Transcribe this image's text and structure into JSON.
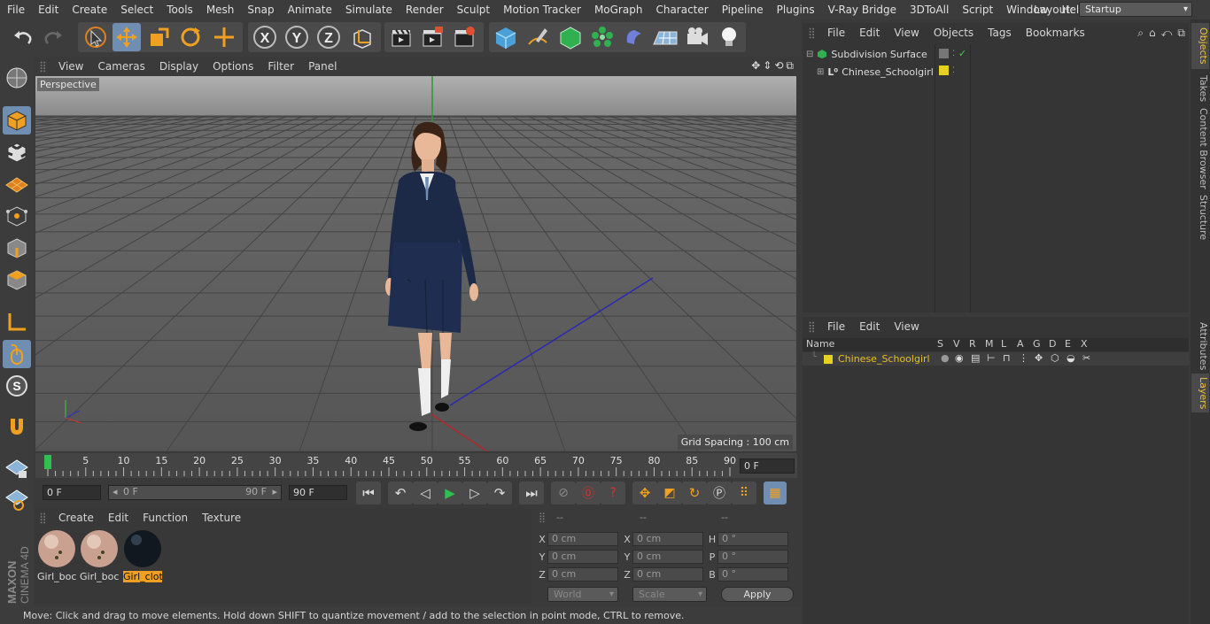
{
  "menubar": {
    "items": [
      "File",
      "Edit",
      "Create",
      "Select",
      "Tools",
      "Mesh",
      "Snap",
      "Animate",
      "Simulate",
      "Render",
      "Sculpt",
      "Motion Tracker",
      "MoGraph",
      "Character",
      "Pipeline",
      "Plugins",
      "V-Ray Bridge",
      "3DToAll",
      "Script",
      "Window",
      "Help"
    ],
    "layout_label": "Layout:",
    "layout_value": "Startup"
  },
  "viewport": {
    "menu": [
      "View",
      "Cameras",
      "Display",
      "Options",
      "Filter",
      "Panel"
    ],
    "label": "Perspective",
    "grid_spacing": "Grid Spacing : 100 cm"
  },
  "timeline": {
    "ticks": [
      "0",
      "5",
      "10",
      "15",
      "20",
      "25",
      "30",
      "35",
      "40",
      "45",
      "50",
      "55",
      "60",
      "65",
      "70",
      "75",
      "80",
      "85",
      "90"
    ],
    "current_frame": "0 F"
  },
  "transport": {
    "start_frame": "0 F",
    "range_start": "0 F",
    "range_end": "90 F",
    "end_frame": "90 F"
  },
  "material_panel": {
    "menu": [
      "Create",
      "Edit",
      "Function",
      "Texture"
    ],
    "materials": [
      {
        "label": "Girl_boc",
        "type": "skin",
        "selected": false
      },
      {
        "label": "Girl_boc",
        "type": "skin",
        "selected": false
      },
      {
        "label": "Girl_clot",
        "type": "dark",
        "selected": true
      }
    ]
  },
  "coords": {
    "headers": [
      "--",
      "--",
      "--"
    ],
    "rows": [
      {
        "a_label": "X",
        "a_val": "0 cm",
        "b_label": "X",
        "b_val": "0 cm",
        "c_label": "H",
        "c_val": "0 °"
      },
      {
        "a_label": "Y",
        "a_val": "0 cm",
        "b_label": "Y",
        "b_val": "0 cm",
        "c_label": "P",
        "c_val": "0 °"
      },
      {
        "a_label": "Z",
        "a_val": "0 cm",
        "b_label": "Z",
        "b_val": "0 cm",
        "c_label": "B",
        "c_val": "0 °"
      }
    ],
    "mode": "World",
    "scale": "Scale",
    "apply": "Apply"
  },
  "status": {
    "text": "Move: Click and drag to move elements. Hold down SHIFT to quantize movement / add to the selection in point mode, CTRL to remove."
  },
  "object_manager": {
    "menu": [
      "File",
      "Edit",
      "View",
      "Objects",
      "Tags",
      "Bookmarks"
    ],
    "objects": [
      {
        "name": "Subdivision Surface"
      },
      {
        "name": "Chinese_Schoolgirl"
      }
    ]
  },
  "layer_manager": {
    "menu": [
      "File",
      "Edit",
      "View"
    ],
    "columns": [
      "Name",
      "S",
      "V",
      "R",
      "M",
      "L",
      "A",
      "G",
      "D",
      "E",
      "X"
    ],
    "layers": [
      {
        "name": "Chinese_Schoolgirl",
        "color": "#e8d020"
      }
    ]
  },
  "side_tabs": {
    "top": [
      "Objects",
      "Takes",
      "Content Browser",
      "Structure"
    ],
    "bottom": [
      "Attributes",
      "Layers"
    ]
  },
  "brand": {
    "maxon": "MAXON",
    "product": "CINEMA 4D"
  },
  "colors": {
    "selected_tool": "#6f8eb2",
    "layer_yellow": "#e8d020",
    "active_tab_text": "#f0c040"
  }
}
